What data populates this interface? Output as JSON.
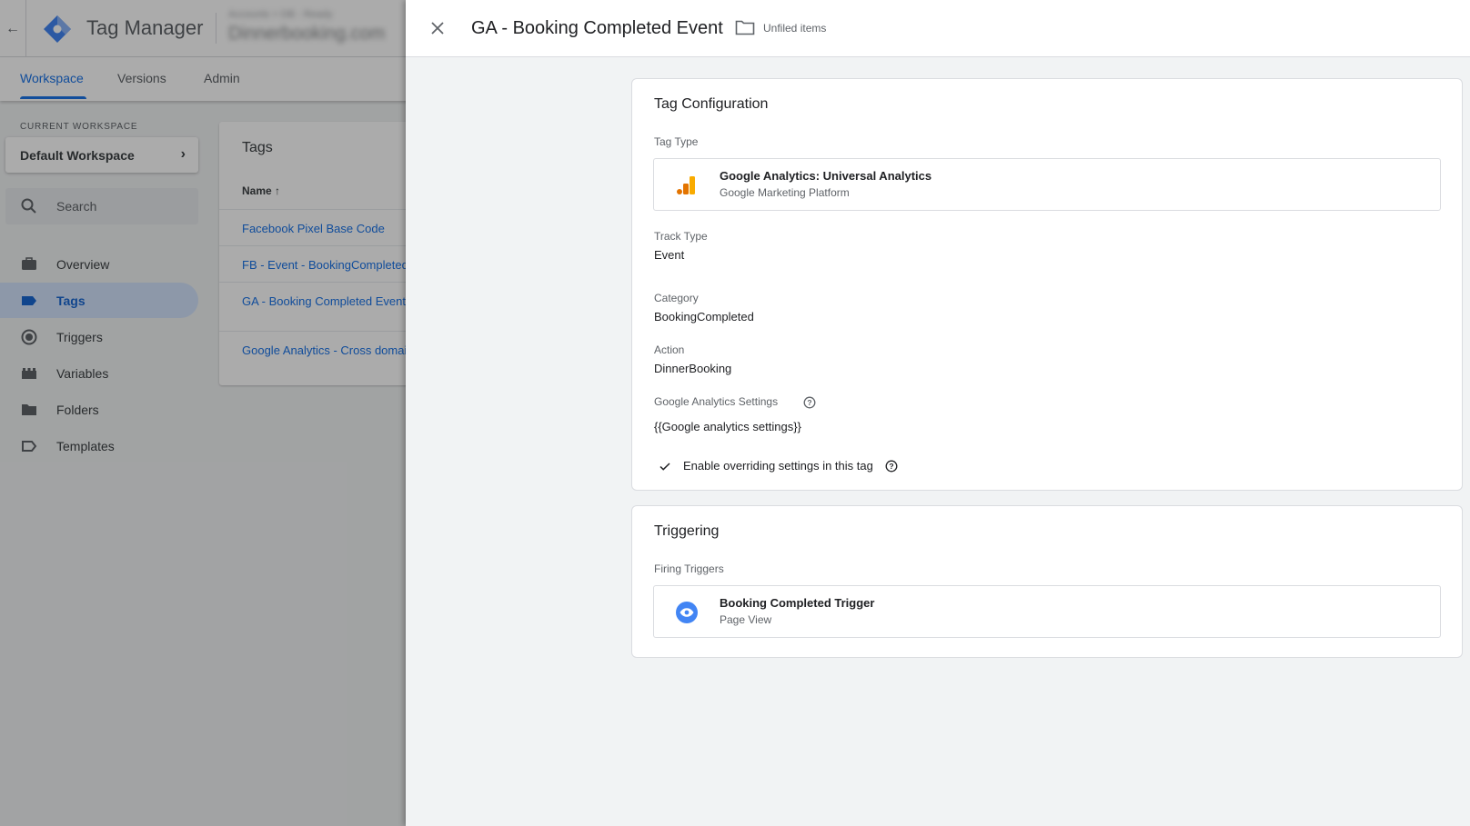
{
  "app": {
    "brand": "Tag Manager",
    "account_line1": "Accounts > DB - Ready",
    "account_line2": "Dinnerbooking.com"
  },
  "tabs": [
    {
      "label": "Workspace",
      "active": true
    },
    {
      "label": "Versions",
      "active": false
    },
    {
      "label": "Admin",
      "active": false
    }
  ],
  "sidebar": {
    "current_workspace_label": "CURRENT WORKSPACE",
    "workspace_name": "Default Workspace",
    "search_placeholder": "Search",
    "items": [
      {
        "label": "Overview",
        "icon": "briefcase-icon"
      },
      {
        "label": "Tags",
        "icon": "tag-icon",
        "active": true
      },
      {
        "label": "Triggers",
        "icon": "trigger-icon"
      },
      {
        "label": "Variables",
        "icon": "variables-icon"
      },
      {
        "label": "Folders",
        "icon": "folder-icon"
      },
      {
        "label": "Templates",
        "icon": "template-icon"
      }
    ]
  },
  "tags_list": {
    "title": "Tags",
    "name_header": "Name",
    "rows": [
      "Facebook Pixel Base Code",
      "FB - Event - BookingCompleted",
      "GA - Booking Completed Event",
      "Google Analytics - Cross domain"
    ]
  },
  "sheet": {
    "title": "GA - Booking Completed Event",
    "folder": "Unfiled items"
  },
  "tag_config": {
    "title": "Tag Configuration",
    "tag_type_label": "Tag Type",
    "tag_type_name": "Google Analytics: Universal Analytics",
    "tag_type_vendor": "Google Marketing Platform",
    "track_type_label": "Track Type",
    "track_type_value": "Event",
    "category_label": "Category",
    "category_value": "BookingCompleted",
    "action_label": "Action",
    "action_value": "DinnerBooking",
    "ga_settings_label": "Google Analytics Settings",
    "ga_settings_value": "{{Google analytics settings}}",
    "override_label": "Enable overriding settings in this tag"
  },
  "triggering": {
    "title": "Triggering",
    "firing_label": "Firing Triggers",
    "trigger_name": "Booking Completed Trigger",
    "trigger_type": "Page View"
  },
  "colors": {
    "accent": "#1a73e8",
    "ga_orange": "#f9ab00",
    "ga_dark_orange": "#e37400"
  }
}
